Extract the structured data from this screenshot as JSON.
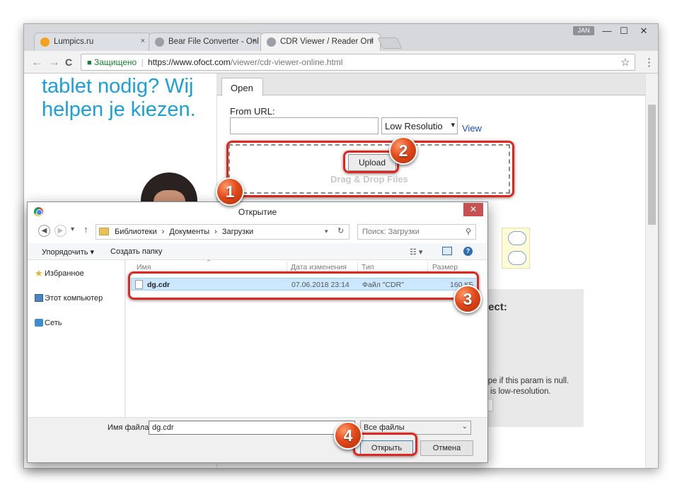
{
  "browser": {
    "tabs": [
      {
        "label": "Lumpics.ru",
        "close": "×"
      },
      {
        "label": "Bear File Converter - Onl",
        "close": "×"
      },
      {
        "label": "CDR Viewer / Reader Onl",
        "close": "×"
      }
    ],
    "user_badge": "JAN",
    "window_controls": {
      "minimize": "—",
      "maximize": "☐",
      "close": "✕"
    },
    "nav": {
      "back": "←",
      "forward": "→",
      "reload": "C"
    },
    "address": {
      "secure_label": "Защищено",
      "separator": "|",
      "host": "https://www.ofoct.com",
      "path": "/viewer/cdr-viewer-online.html"
    },
    "star": "☆",
    "menu": "⋮"
  },
  "page": {
    "ad_text": "tablet nodig? Wij helpen je kiezen.",
    "open_tab": "Open",
    "from_url_label": "From URL:",
    "resolution_select": "Low Resolutio",
    "resolution_arrow": "▾",
    "view_link": "View",
    "upload_button": "Upload",
    "drag_drop_text": "Drag & Drop Files",
    "side_heading": "ject:",
    "side_text_1": "ype if this param is null.",
    "side_text_2": "it is low-resolution."
  },
  "dialog": {
    "title": "Открытие",
    "close": "✕",
    "breadcrumb": [
      "Библиотеки",
      "Документы",
      "Загрузки"
    ],
    "breadcrumb_sep": "›",
    "search_placeholder": "Поиск: Загрузки",
    "organize": "Упорядочить",
    "new_folder": "Создать папку",
    "sidebar": [
      {
        "label": "Избранное",
        "icon": "star-icon"
      },
      {
        "label": "Этот компьютер",
        "icon": "computer-icon"
      },
      {
        "label": "Сеть",
        "icon": "network-icon"
      }
    ],
    "columns": {
      "name": "Имя",
      "date": "Дата изменения",
      "type": "Тип",
      "size": "Размер"
    },
    "files": [
      {
        "name": "dg.cdr",
        "date": "07.06.2018 23:14",
        "type": "Файл \"CDR\"",
        "size": "160 КБ"
      }
    ],
    "filename_label": "Имя файла:",
    "filename_value": "dg.cdr",
    "filetype_value": "Все файлы",
    "open_button": "Открыть",
    "cancel_button": "Отмена"
  },
  "annotations": {
    "badge1": "1",
    "badge2": "2",
    "badge3": "3",
    "badge4": "4"
  },
  "colors": {
    "highlight": "#e0261f",
    "badge": "#e24a1a",
    "ad_text": "#1aa0dc",
    "selected_row": "#cce8ff",
    "link": "#1a4dc4"
  }
}
